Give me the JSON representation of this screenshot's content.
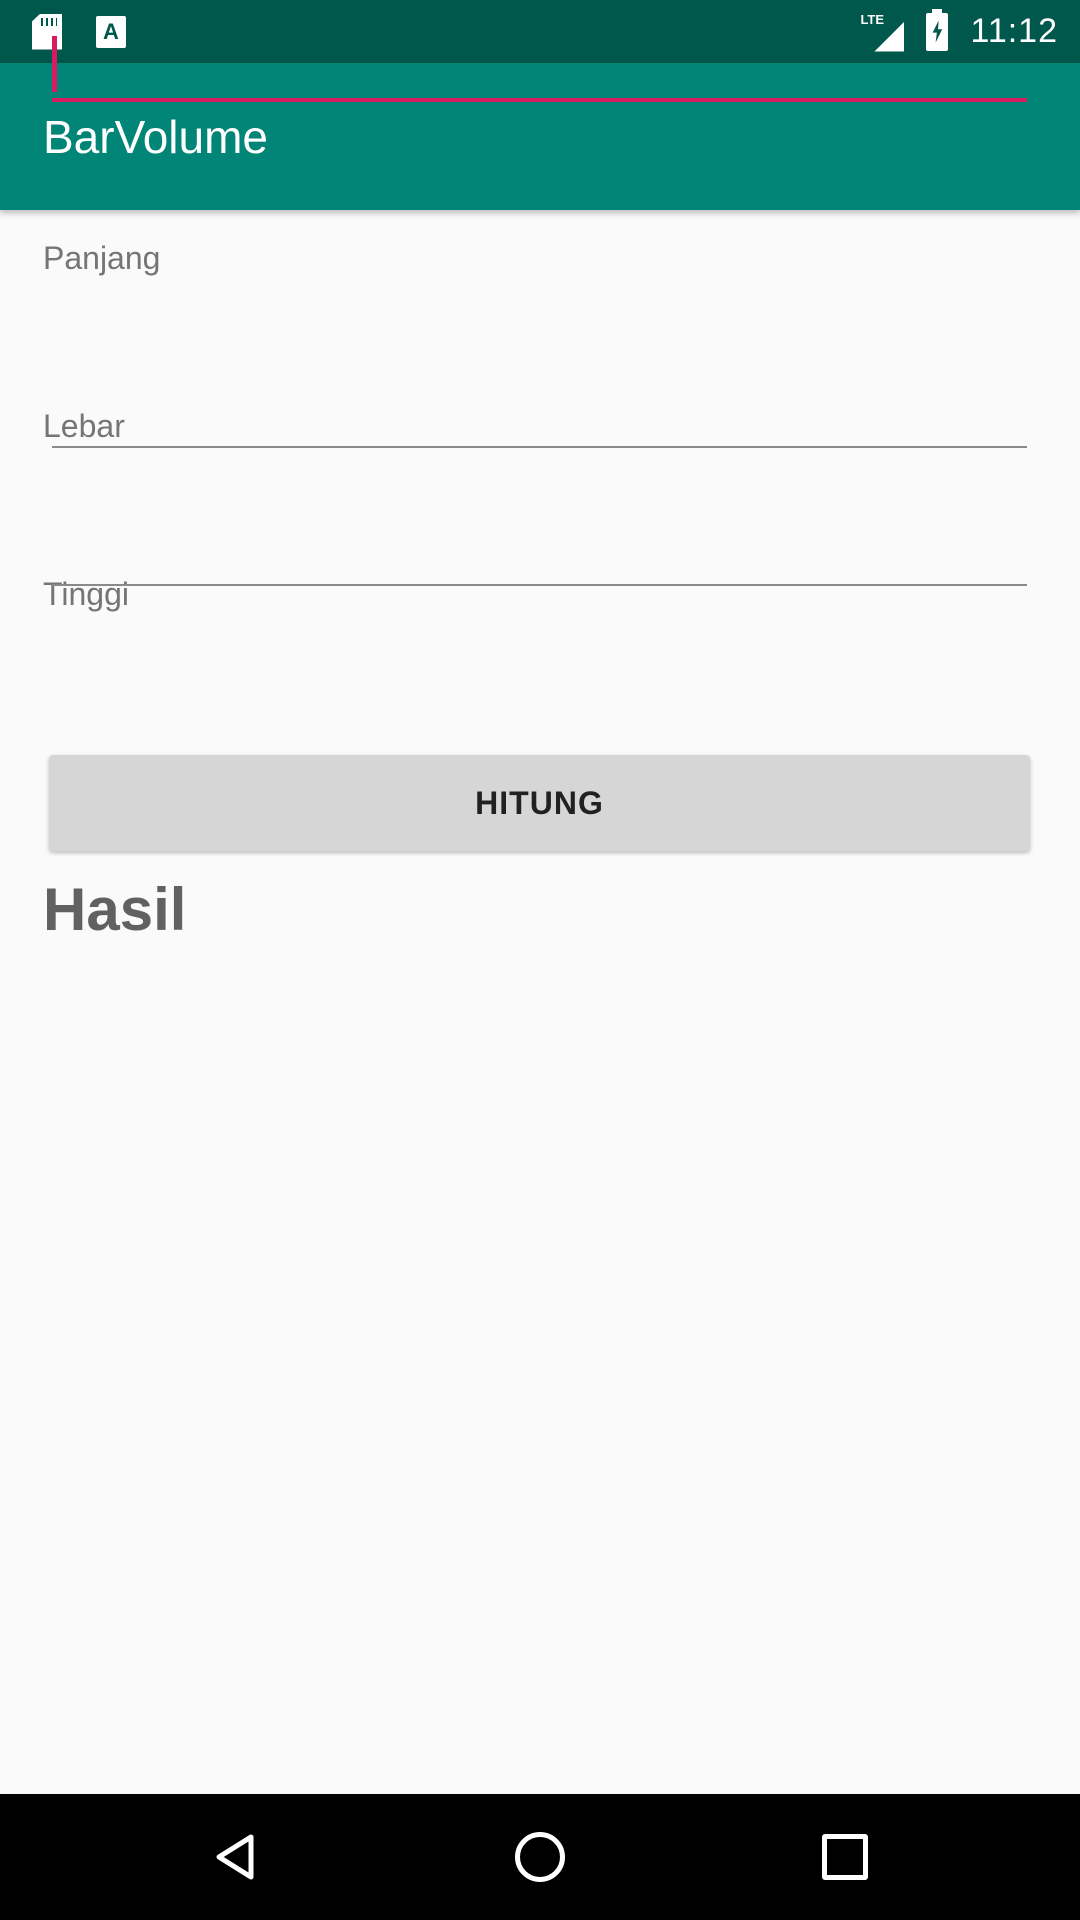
{
  "status_bar": {
    "time": "11:12",
    "network": "LTE",
    "icons": [
      "sd-card-icon",
      "a-notification-icon",
      "signal-icon",
      "battery-charging-icon"
    ]
  },
  "app_bar": {
    "title": "BarVolume",
    "color": "#008577"
  },
  "form": {
    "panjang": {
      "label": "Panjang",
      "value": ""
    },
    "lebar": {
      "label": "Lebar",
      "value": ""
    },
    "tinggi": {
      "label": "Tinggi",
      "value": ""
    },
    "accent_color": "#D81B60"
  },
  "hitung_button": {
    "label": "HITUNG"
  },
  "result": {
    "heading": "Hasil"
  },
  "nav_bar": {
    "icons": [
      "back-icon",
      "home-icon",
      "recent-apps-icon"
    ]
  }
}
